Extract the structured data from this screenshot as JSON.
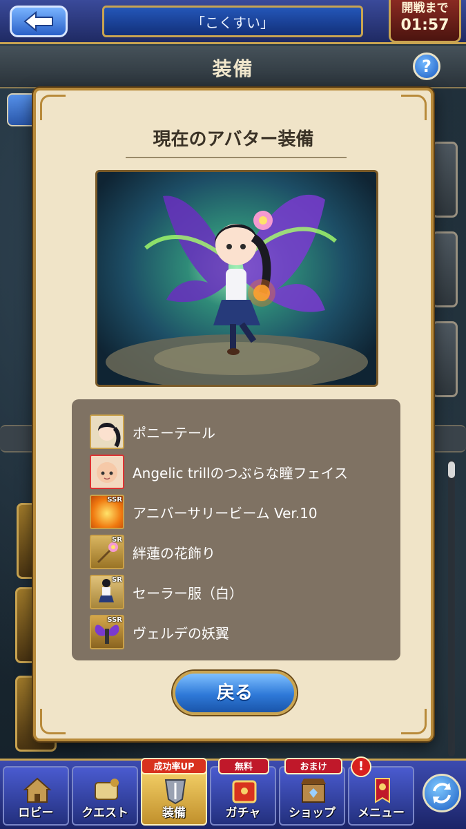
{
  "header": {
    "title": "「こくすい」",
    "timer_label": "開戦まで",
    "timer_value": "01:57",
    "section_title": "装備",
    "help_label": "?"
  },
  "modal": {
    "title": "現在のアバター装備",
    "items": [
      {
        "name": "ポニーテール",
        "rarity": "",
        "icon": "hair-icon",
        "bg": "#e9dcc0"
      },
      {
        "name": "Angelic trillのつぶらな瞳フェイス",
        "rarity": "",
        "icon": "face-icon",
        "bg": "#f3d9c0"
      },
      {
        "name": "アニバーサリービーム Ver.10",
        "rarity": "SSR",
        "icon": "beam-icon",
        "bg": "#f0a020"
      },
      {
        "name": "絆蓮の花飾り",
        "rarity": "SR",
        "icon": "flower-ornament-icon",
        "bg": "#c9a04a"
      },
      {
        "name": "セーラー服（白）",
        "rarity": "SR",
        "icon": "sailor-uniform-icon",
        "bg": "#d8b466"
      },
      {
        "name": "ヴェルデの妖翼",
        "rarity": "SSR",
        "icon": "wings-icon",
        "bg": "#c79a3a"
      }
    ],
    "back_button": "戻る"
  },
  "nav": {
    "items": [
      {
        "label": "ロビー",
        "icon": "lobby-icon"
      },
      {
        "label": "クエスト",
        "icon": "quest-icon"
      },
      {
        "label": "装備",
        "icon": "equipment-icon",
        "badge": "成功率UP"
      },
      {
        "label": "ガチャ",
        "icon": "gacha-icon",
        "badge": "無料"
      },
      {
        "label": "ショップ",
        "icon": "shop-icon",
        "badge": "おまけ"
      },
      {
        "label": "メニュー",
        "icon": "menu-icon",
        "badge": "!"
      }
    ]
  },
  "colors": {
    "accent_gold": "#c9a451",
    "modal_bg": "#f0e4c8",
    "panel_bg": "#7f7263",
    "nav_active": "#f6d36a"
  }
}
